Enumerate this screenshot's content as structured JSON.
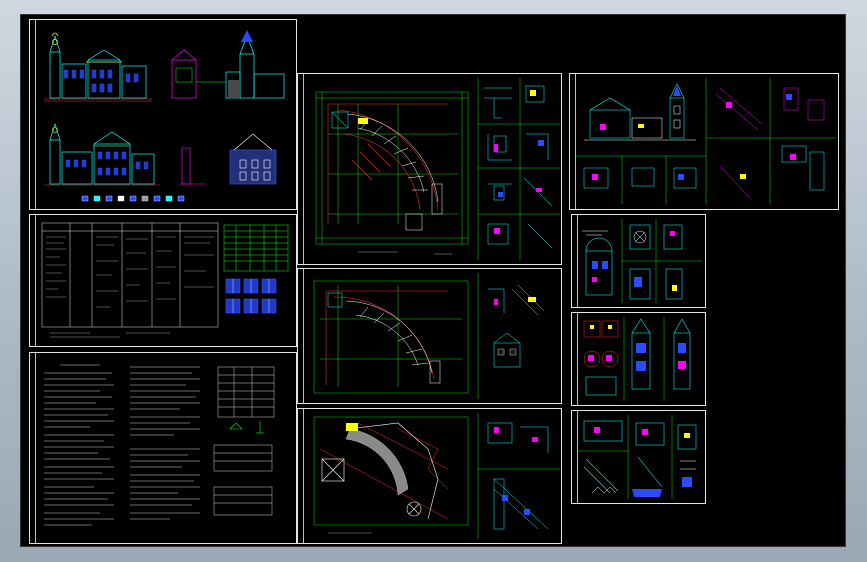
{
  "view": {
    "background": "#000000",
    "frame_color": "#e6e6e6"
  },
  "colors": {
    "green": "#00ff00",
    "red": "#ff2a2a",
    "cyan": "#00ffff",
    "blue": "#3a5cff",
    "yellow": "#ffff00",
    "magenta": "#ff00ff",
    "white": "#ffffff",
    "grey": "#b8b8b8"
  },
  "sheets": [
    {
      "id": "elevations",
      "content": "building-elevations"
    },
    {
      "id": "door-window-schedule",
      "content": "schedule-table"
    },
    {
      "id": "design-notes",
      "content": "notes-text"
    },
    {
      "id": "floor-plan-1",
      "content": "curved-floor-plan"
    },
    {
      "id": "floor-plan-2",
      "content": "curved-floor-plan"
    },
    {
      "id": "roof-plan",
      "content": "roof-plan"
    },
    {
      "id": "sections-details",
      "content": "sections-and-details"
    },
    {
      "id": "detail-sheet-1",
      "content": "tower-details"
    },
    {
      "id": "detail-sheet-2",
      "content": "tower-details"
    },
    {
      "id": "detail-sheet-3",
      "content": "stair-details"
    }
  ]
}
